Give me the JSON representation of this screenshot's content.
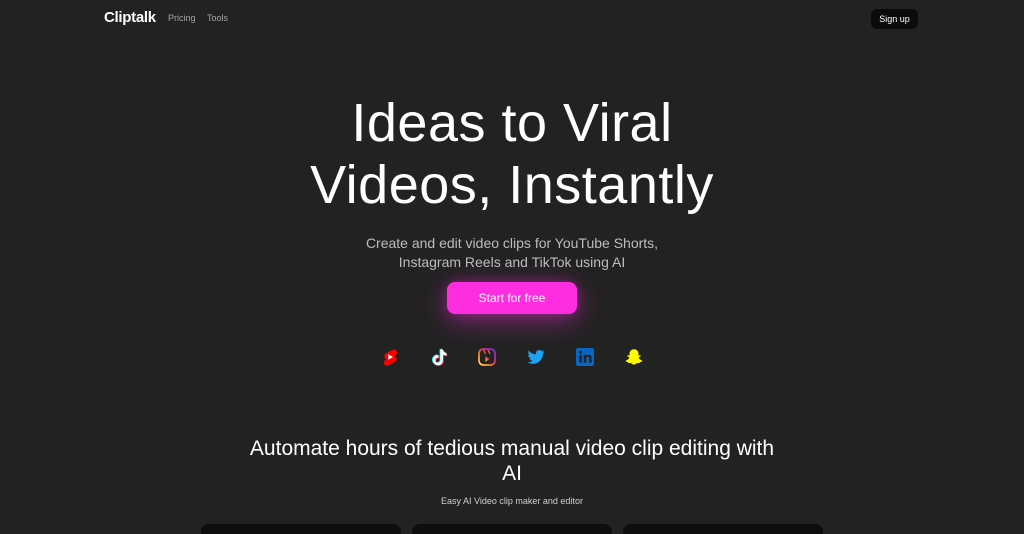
{
  "header": {
    "logo": "Cliptalk",
    "nav": [
      {
        "label": "Pricing"
      },
      {
        "label": "Tools"
      }
    ],
    "signup_label": "Sign up"
  },
  "hero": {
    "title_line1": "Ideas to Viral",
    "title_line2": "Videos, Instantly",
    "subtitle_line1": "Create and edit video clips for YouTube Shorts,",
    "subtitle_line2": "Instagram Reels and TikTok using AI",
    "cta_label": "Start for free"
  },
  "platforms": [
    {
      "icon": "youtube-shorts-icon",
      "color": "#ff0000"
    },
    {
      "icon": "tiktok-icon",
      "color": "#ffffff"
    },
    {
      "icon": "instagram-reels-icon",
      "color": "#e1306c"
    },
    {
      "icon": "twitter-icon",
      "color": "#1da1f2"
    },
    {
      "icon": "linkedin-icon",
      "color": "#0a66c2"
    },
    {
      "icon": "snapchat-icon",
      "color": "#fffc00"
    }
  ],
  "section": {
    "title_line1": "Automate hours of tedious manual video clip editing with",
    "title_line2": "AI",
    "subtitle": "Easy AI Video clip maker and editor"
  },
  "colors": {
    "background": "#222222",
    "accent": "#ff2de0",
    "card": "#0d0d0d"
  }
}
